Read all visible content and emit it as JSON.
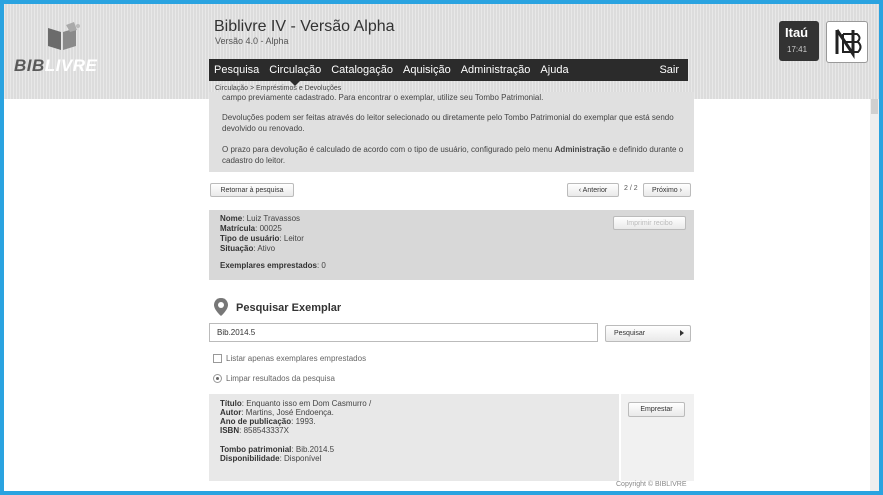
{
  "app": {
    "logo_part1": "BIB",
    "logo_part2": "LIVRE",
    "title": "Biblivre IV - Versão Alpha",
    "version": "Versão 4.0 - Alpha"
  },
  "menu": {
    "items": [
      "Pesquisa",
      "Circulação",
      "Catalogação",
      "Aquisição",
      "Administração",
      "Ajuda"
    ],
    "logout": "Sair"
  },
  "bank": {
    "name": "Itaú",
    "time": "17:41"
  },
  "breadcrumb": "Circulação > Empréstimos e Devoluções",
  "info": {
    "p0": "campo previamente cadastrado. Para encontrar o exemplar, utilize seu Tombo Patrimonial.",
    "p1": "Devoluções podem ser feitas através do leitor selecionado ou diretamente pelo Tombo Patrimonial do exemplar que está sendo devolvido ou renovado.",
    "p2_a": "O prazo para devolução é calculado de acordo com o tipo de usuário, configurado pelo menu ",
    "p2_b": "Administração",
    "p2_c": " e definido durante o cadastro do leitor."
  },
  "nav": {
    "back_label": "Retornar à pesquisa",
    "prev_label": "‹ Anterior",
    "page": "2 / 2",
    "next_label": "Próximo ›"
  },
  "reader": {
    "name_label": "Nome",
    "name": ": Luiz Travassos",
    "reg_label": "Matrícula",
    "reg": ": 00025",
    "type_label": "Tipo de usuário",
    "type": ": Leitor",
    "status_label": "Situação",
    "status": ": Ativo",
    "loans_label": "Exemplares emprestados",
    "loans": ": 0",
    "print_label": "Imprimir recibo"
  },
  "search": {
    "title": "Pesquisar Exemplar",
    "value": "Bib.2014.5",
    "button": "Pesquisar",
    "only_lent": "Listar apenas exemplares emprestados",
    "clear": "Limpar resultados da pesquisa"
  },
  "result": {
    "title_label": "Título",
    "title": ": Enquanto isso em Dom Casmurro /",
    "author_label": "Autor",
    "author": ": Martins, José Endoença.",
    "year_label": "Ano de publicação",
    "year": ": 1993.",
    "isbn_label": "ISBN",
    "isbn": ": 858543337X",
    "tombo_label": "Tombo patrimonial",
    "tombo": ": Bib.2014.5",
    "avail_label": "Disponibilidade",
    "avail": ": Disponível",
    "lend_button": "Emprestar"
  },
  "footer": {
    "copyright": "Copyright © BIBLIVRE"
  },
  "colors": {
    "frame": "#2aa3e0",
    "menubar": "#2b2b2b",
    "bank": "#333333"
  }
}
